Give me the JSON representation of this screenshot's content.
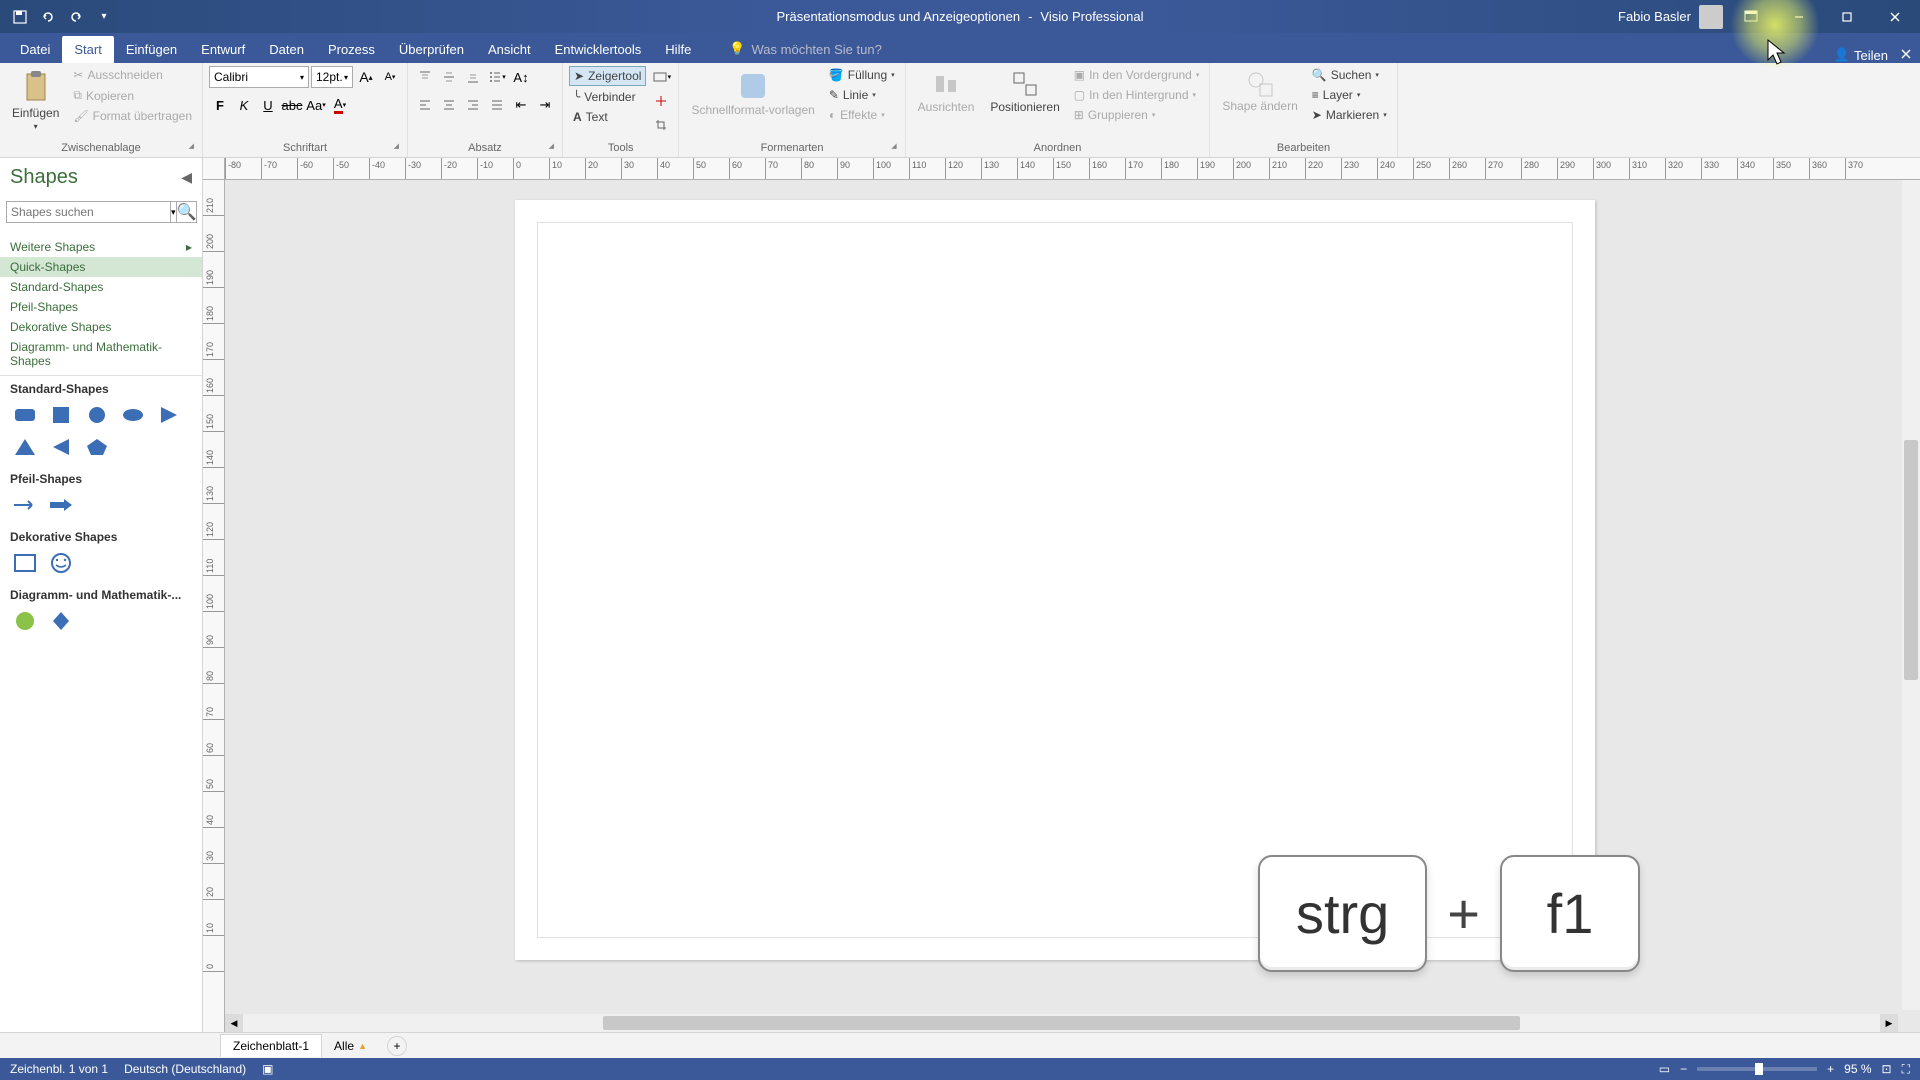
{
  "title": {
    "doc": "Präsentationsmodus und Anzeigeoptionen",
    "app": "Visio Professional",
    "user": "Fabio Basler"
  },
  "tabs": {
    "datei": "Datei",
    "start": "Start",
    "einfuegen": "Einfügen",
    "entwurf": "Entwurf",
    "daten": "Daten",
    "prozess": "Prozess",
    "ueberpruefen": "Überprüfen",
    "ansicht": "Ansicht",
    "entwicklertools": "Entwicklertools",
    "hilfe": "Hilfe",
    "tellme": "Was möchten Sie tun?",
    "teilen": "Teilen"
  },
  "ribbon": {
    "zwischenablage": {
      "label": "Zwischenablage",
      "einfuegen": "Einfügen",
      "ausschneiden": "Ausschneiden",
      "kopieren": "Kopieren",
      "format": "Format übertragen"
    },
    "schriftart": {
      "label": "Schriftart",
      "font": "Calibri",
      "size": "12pt."
    },
    "absatz": {
      "label": "Absatz"
    },
    "tools": {
      "label": "Tools",
      "zeiger": "Zeigertool",
      "verbinder": "Verbinder",
      "text": "Text"
    },
    "formenarten": {
      "label": "Formenarten",
      "schnellformat": "Schnellformat-vorlagen",
      "fuellung": "Füllung",
      "linie": "Linie",
      "effekte": "Effekte"
    },
    "anordnen": {
      "label": "Anordnen",
      "ausrichten": "Ausrichten",
      "positionieren": "Positionieren",
      "vordergrund": "In den Vordergrund",
      "hintergrund": "In den Hintergrund",
      "gruppieren": "Gruppieren"
    },
    "bearbeiten": {
      "label": "Bearbeiten",
      "shape_aendern": "Shape ändern",
      "suchen": "Suchen",
      "layer": "Layer",
      "markieren": "Markieren"
    }
  },
  "shapes": {
    "title": "Shapes",
    "search_placeholder": "Shapes suchen",
    "cat_weitere": "Weitere Shapes",
    "cat_quick": "Quick-Shapes",
    "cat_standard": "Standard-Shapes",
    "cat_pfeil": "Pfeil-Shapes",
    "cat_dekorative": "Dekorative Shapes",
    "cat_diagramm": "Diagramm- und Mathematik-Shapes",
    "sec_standard": "Standard-Shapes",
    "sec_pfeil": "Pfeil-Shapes",
    "sec_dekorative": "Dekorative Shapes",
    "sec_diagramm": "Diagramm- und Mathematik-..."
  },
  "ruler_h": [
    "-80",
    "-70",
    "-60",
    "-50",
    "-40",
    "-30",
    "-20",
    "-10",
    "0",
    "10",
    "20",
    "30",
    "40",
    "50",
    "60",
    "70",
    "80",
    "90",
    "100",
    "110",
    "120",
    "130",
    "140",
    "150",
    "160",
    "170",
    "180",
    "190",
    "200",
    "210",
    "220",
    "230",
    "240",
    "250",
    "260",
    "270",
    "280",
    "290",
    "300",
    "310",
    "320",
    "330",
    "340",
    "350",
    "360",
    "370"
  ],
  "ruler_v": [
    "210",
    "200",
    "190",
    "180",
    "170",
    "160",
    "150",
    "140",
    "130",
    "120",
    "110",
    "100",
    "90",
    "80",
    "70",
    "60",
    "50",
    "40",
    "30",
    "20",
    "10",
    "0"
  ],
  "overlay": {
    "key1": "strg",
    "plus": "+",
    "key2": "f1"
  },
  "page_tabs": {
    "sheet1": "Zeichenblatt-1",
    "alle": "Alle"
  },
  "status": {
    "page": "Zeichenbl. 1 von 1",
    "lang": "Deutsch (Deutschland)",
    "zoom": "95 %"
  }
}
